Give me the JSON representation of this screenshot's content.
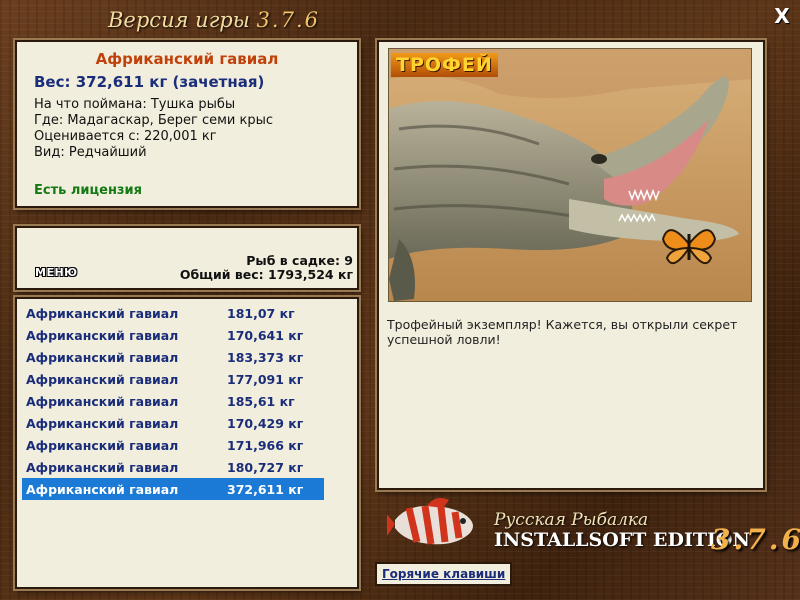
{
  "window": {
    "title": "Версия игры",
    "version": "3.7.6",
    "close_label": "X"
  },
  "fish_info": {
    "name": "Африканский гавиал",
    "weight_line": "Вес: 372,611 кг (зачетная)",
    "bait_line": "На что поймана: Тушка рыбы",
    "where_line": "Где: Мадагаскар, Берег семи крыс",
    "valued_line": "Оценивается с: 220,001 кг",
    "kind_line": "Вид: Редчайший",
    "license": "Есть лицензия"
  },
  "summary": {
    "menu_label": "МЕНЮ",
    "fish_count": "Рыб в садке: 9",
    "total_weight": "Общий вес: 1793,524 кг"
  },
  "catch_list": [
    {
      "name": "Африканский гавиал",
      "weight": "181,07 кг"
    },
    {
      "name": "Африканский гавиал",
      "weight": "170,641 кг"
    },
    {
      "name": "Африканский гавиал",
      "weight": "183,373 кг"
    },
    {
      "name": "Африканский гавиал",
      "weight": "177,091 кг"
    },
    {
      "name": "Африканский гавиал",
      "weight": "185,61 кг"
    },
    {
      "name": "Африканский гавиал",
      "weight": "170,429 кг"
    },
    {
      "name": "Африканский гавиал",
      "weight": "171,966 кг"
    },
    {
      "name": "Африканский гавиал",
      "weight": "180,727 кг"
    },
    {
      "name": "Африканский гавиал",
      "weight": "372,611 кг",
      "selected": true
    }
  ],
  "trophy": {
    "label": "ТРОФЕЙ",
    "description": "Трофейный экземпляр! Кажется, вы открыли секрет успешной ловли!"
  },
  "brand": {
    "line1": "Русская Рыбалка",
    "line2": "INSTALLSOFT EDITION",
    "version": "3.7.6"
  },
  "hotkeys_label": "Горячие клавиши",
  "colors": {
    "selected_row": "#1b7ad6",
    "fish_name": "#c0420a",
    "license": "#137a13",
    "list_text": "#1a2d7a"
  }
}
